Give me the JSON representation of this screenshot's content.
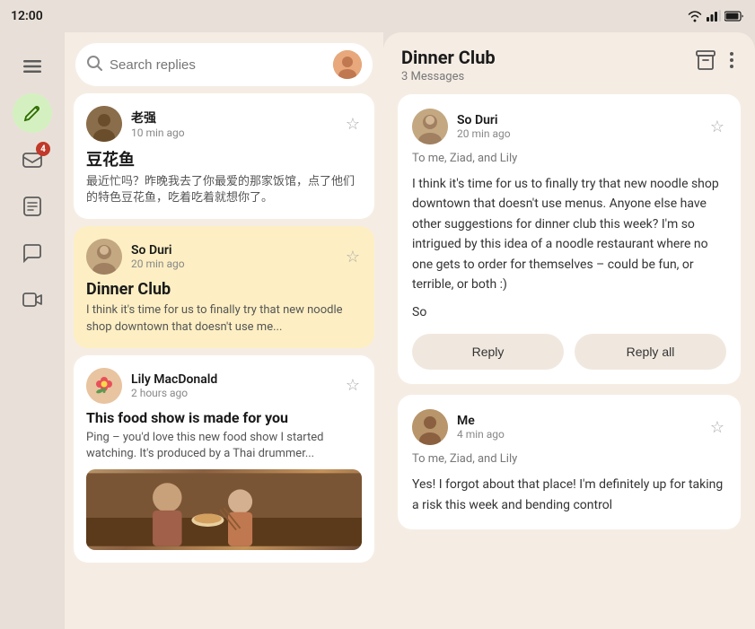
{
  "statusBar": {
    "time": "12:00"
  },
  "sidebar": {
    "items": [
      {
        "id": "menu",
        "icon": "☰",
        "active": false,
        "badge": null
      },
      {
        "id": "compose",
        "icon": "✏",
        "active": true,
        "badge": null
      },
      {
        "id": "inbox",
        "icon": "📥",
        "active": false,
        "badge": "4"
      },
      {
        "id": "notes",
        "icon": "☰",
        "active": false,
        "badge": null
      },
      {
        "id": "chat",
        "icon": "💬",
        "active": false,
        "badge": null
      },
      {
        "id": "video",
        "icon": "🎬",
        "active": false,
        "badge": null
      }
    ]
  },
  "search": {
    "placeholder": "Search replies"
  },
  "messageList": {
    "messages": [
      {
        "id": "msg1",
        "sender": "老强",
        "time": "10 min ago",
        "title": "豆花鱼",
        "preview": "最近忙吗？昨晚我去了你最爱的那家饭馆，点了他们的特色豆花鱼，吃着吃着就想你了。",
        "selected": false,
        "hasImage": false
      },
      {
        "id": "msg2",
        "sender": "So Duri",
        "time": "20 min ago",
        "title": "Dinner Club",
        "preview": "I think it's time for us to finally try that new noodle shop downtown that doesn't use me...",
        "selected": true,
        "hasImage": false
      },
      {
        "id": "msg3",
        "sender": "Lily MacDonald",
        "time": "2 hours ago",
        "title": "This food show is made for you",
        "preview": "Ping – you'd love this new food show I started watching. It's produced by a Thai drummer...",
        "selected": false,
        "hasImage": true
      }
    ]
  },
  "rightPanel": {
    "title": "Dinner Club",
    "messageCount": "3 Messages",
    "emails": [
      {
        "id": "email1",
        "sender": "So Duri",
        "time": "20 min ago",
        "to": "To me, Ziad, and Lily",
        "body": "I think it's time for us to finally try that new noodle shop downtown that doesn't use menus. Anyone else have other suggestions for dinner club this week? I'm so intrigued by this idea of a noodle restaurant where no one gets to order for themselves – could be fun, or terrible, or both :)",
        "signature": "So",
        "showReply": true
      },
      {
        "id": "email2",
        "sender": "Me",
        "time": "4 min ago",
        "to": "To me, Ziad, and Lily",
        "body": "Yes! I forgot about that place! I'm definitely up for taking a risk this week and bending control",
        "signature": "",
        "showReply": false
      }
    ],
    "replyButton": "Reply",
    "replyAllButton": "Reply all"
  }
}
